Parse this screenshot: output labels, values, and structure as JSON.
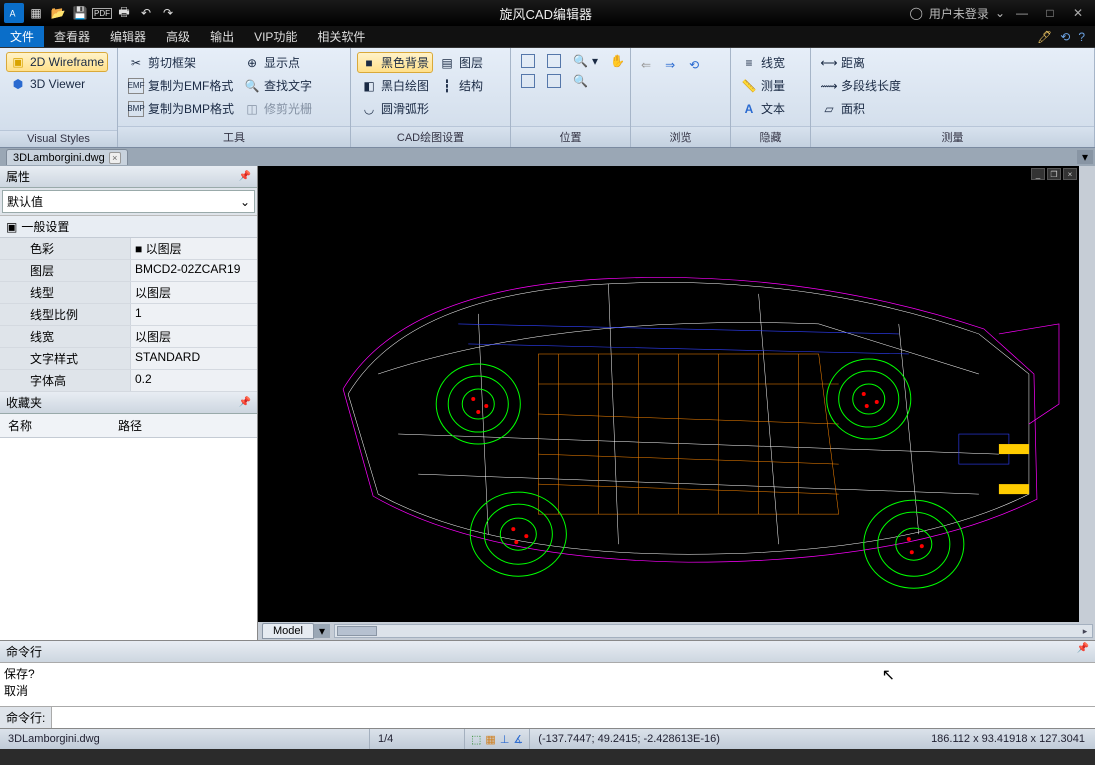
{
  "app": {
    "title": "旋风CAD编辑器",
    "user_status": "用户未登录"
  },
  "menu": {
    "tabs": [
      "文件",
      "查看器",
      "编辑器",
      "高级",
      "输出",
      "VIP功能",
      "相关软件"
    ],
    "active": 0
  },
  "ribbon": {
    "visual_styles": {
      "label": "Visual Styles",
      "wire2d": "2D Wireframe",
      "viewer3d": "3D Viewer"
    },
    "tools": {
      "label": "工具",
      "clip": "剪切框架",
      "copy_emf": "复制为EMF格式",
      "copy_bmp": "复制为BMP格式",
      "show_points": "显示点",
      "find_text": "查找文字",
      "trim": "修剪光栅"
    },
    "cad_settings": {
      "label": "CAD绘图设置",
      "black_bg": "黑色背景",
      "bw_draw": "黑白绘图",
      "arc_smooth": "圆滑弧形",
      "layers": "图层",
      "structure": "结构"
    },
    "position": {
      "label": "位置"
    },
    "browse": {
      "label": "浏览"
    },
    "hide": {
      "label": "隐藏",
      "linewidth": "线宽",
      "measure": "测量",
      "text": "文本"
    },
    "measure": {
      "label": "测量",
      "distance": "距离",
      "polyline_len": "多段线长度",
      "area": "面积"
    }
  },
  "doc": {
    "tab": "3DLamborgini.dwg"
  },
  "props": {
    "title": "属性",
    "default": "默认值",
    "section": "一般设置",
    "rows": [
      {
        "k": "色彩",
        "v": "■ 以图层"
      },
      {
        "k": "图层",
        "v": "BMCD2-02ZCAR19"
      },
      {
        "k": "线型",
        "v": "以图层"
      },
      {
        "k": "线型比例",
        "v": "1"
      },
      {
        "k": "线宽",
        "v": "以图层"
      },
      {
        "k": "文字样式",
        "v": "STANDARD"
      },
      {
        "k": "字体高",
        "v": "0.2"
      }
    ]
  },
  "favorites": {
    "title": "收藏夹",
    "col_name": "名称",
    "col_path": "路径"
  },
  "model_tab": "Model",
  "command": {
    "title": "命令行",
    "history": "保存?\n取消",
    "prompt": "命令行:"
  },
  "status": {
    "file": "3DLamborgini.dwg",
    "progress": "1/4",
    "coords": "(-137.7447; 49.2415; -2.428613E-16)",
    "dims": "186.112 x 93.41918 x 127.3041"
  }
}
